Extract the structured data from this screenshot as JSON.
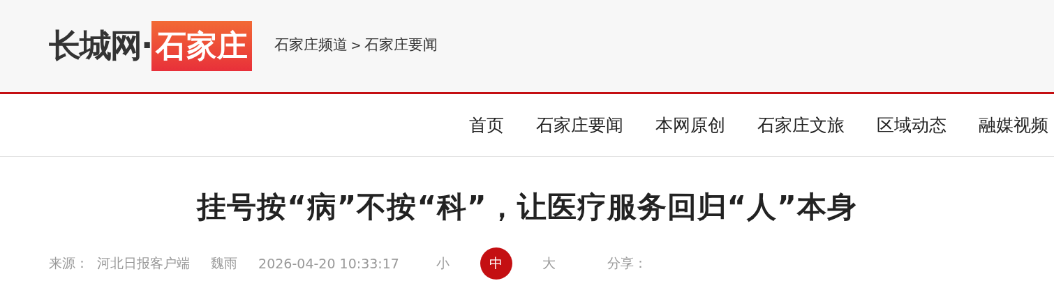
{
  "logo": {
    "site": "长城网·",
    "channel": "石家庄"
  },
  "breadcrumb": [
    "石家庄频道",
    ">",
    "石家庄要闻"
  ],
  "nav": [
    {
      "label": "首页"
    },
    {
      "label": "石家庄要闻"
    },
    {
      "label": "本网原创"
    },
    {
      "label": "石家庄文旅"
    },
    {
      "label": "区域动态"
    },
    {
      "label": "融媒视频"
    }
  ],
  "title": "挂号按“病”不按“科”，让医疗服务回归“人”本身",
  "meta": {
    "source": "来源：  河北日报客户端",
    "author": "魏雨",
    "time": "2026-04-20 10:33:17",
    "font_sizes": [
      {
        "label": "小",
        "selected": false
      },
      {
        "label": "中",
        "selected": true
      },
      {
        "label": "大",
        "selected": false
      }
    ],
    "share": "分享："
  }
}
